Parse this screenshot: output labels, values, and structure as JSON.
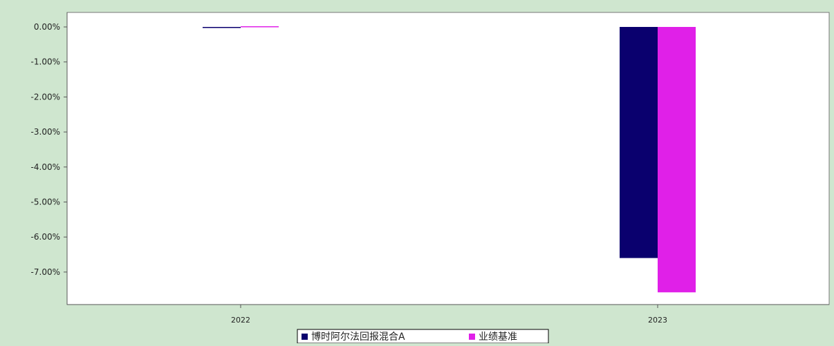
{
  "chart_data": {
    "type": "bar",
    "categories": [
      "2022",
      "2023"
    ],
    "series": [
      {
        "name": "博时阿尔法回报混合A",
        "values": [
          -0.03,
          -6.6
        ]
      },
      {
        "name": "业绩基准",
        "values": [
          0.02,
          -7.58
        ]
      }
    ],
    "yticks": [
      "0.00%",
      "-1.00%",
      "-2.00%",
      "-3.00%",
      "-4.00%",
      "-5.00%",
      "-6.00%",
      "-7.00%"
    ],
    "ylim": [
      -7.95,
      0.45
    ],
    "grid": false,
    "legend_position": "bottom-center",
    "colors": {
      "series": [
        "#0a006e",
        "#e020e8"
      ],
      "background": "#cfe6cf",
      "plot": "#ffffff",
      "axis": "#555555"
    }
  }
}
